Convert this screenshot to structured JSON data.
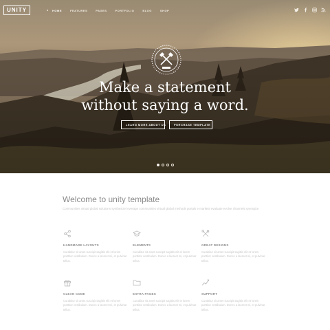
{
  "colors": {
    "hero_text": "#ffffff",
    "heading": "#8a8a8a",
    "body_text": "#c4c4c4",
    "icon": "#b9b9b9"
  },
  "header": {
    "logo": "UNITY",
    "nav": [
      "HOME",
      "FEATURES",
      "PAGES",
      "PORTFOLIO",
      "BLOG",
      "SHOP"
    ],
    "social_icons": [
      "twitter-icon",
      "facebook-icon",
      "instagram-icon",
      "rss-icon"
    ]
  },
  "hero": {
    "emblem_icon": "crossed-axes-emblem",
    "headline_line1": "Make a statement",
    "headline_line2": "without saying a word.",
    "button_primary": "LEARN MORE ABOUT US",
    "button_secondary": "PURCHASE TEMPLATE",
    "slides": 4,
    "active_slide": 1
  },
  "welcome": {
    "title": "Welcome to unity template",
    "text": "Communities virtual global solutions synthesize leverage communities virtual global methods portals e markets evaluate evolve channels synergize"
  },
  "features": [
    {
      "icon": "share-icon",
      "title": "HANDMADE LAYOUTS",
      "text": "Curabitur sit amet suscipit sagittis elit et lorem porttitor vestibulum. Donec a laoreet mi, et pulvinar tellus."
    },
    {
      "icon": "graduation-cap-icon",
      "title": "ELEMENTS",
      "text": "Curabitur sit amet suscipit sagittis elit et lorem porttitor vestibulum. Donec a laoreet mi, et pulvinar tellus."
    },
    {
      "icon": "tools-icon",
      "title": "GREAT DESIGNS",
      "text": "Curabitur sit amet suscipit sagittis elit et lorem porttitor vestibulum. Donec a laoreet mi, et pulvinar tellus."
    },
    {
      "icon": "gift-icon",
      "title": "CLEAN CODE",
      "text": "Curabitur sit amet suscipit sagittis elit et lorem porttitor vestibulum. Donec a laoreet mi, et pulvinar tellus."
    },
    {
      "icon": "folder-icon",
      "title": "EXTRA PAGES",
      "text": "Curabitur sit amet suscipit sagittis elit et lorem porttitor vestibulum. Donec a laoreet mi, et pulvinar tellus."
    },
    {
      "icon": "chart-line-icon",
      "title": "SUPPORT",
      "text": "Curabitur sit amet suscipit sagittis elit et lorem porttitor vestibulum. Donec a laoreet mi, et pulvinar tellus."
    }
  ]
}
